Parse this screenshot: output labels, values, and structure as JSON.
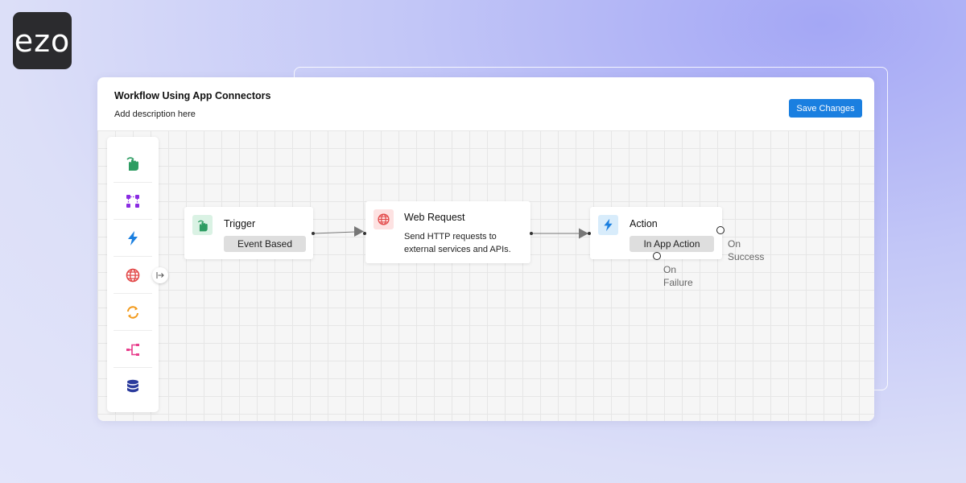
{
  "brand": {
    "logo_text": "ezo"
  },
  "workflow": {
    "title": "Workflow Using App Connectors",
    "description": "Add description here",
    "save_label": "Save Changes"
  },
  "nodes": {
    "trigger": {
      "title": "Trigger",
      "chip": "Event Based"
    },
    "web_request": {
      "title": "Web Request",
      "description_line1": "Send HTTP requests to",
      "description_line2": "external services and APIs."
    },
    "action": {
      "title": "Action",
      "chip": "In App Action",
      "on_success_line1": "On",
      "on_success_line2": "Success",
      "on_failure_line1": "On",
      "on_failure_line2": "Failure"
    }
  },
  "toolbar": {
    "icons": [
      "hand-tap-icon",
      "workflow-nodes-icon",
      "lightning-icon",
      "globe-icon",
      "refresh-icon",
      "branch-icon",
      "database-icon"
    ]
  },
  "colors": {
    "accent_blue": "#1a7fe0",
    "trigger_green": "#2d9c62",
    "nodes_purple": "#8a2be2",
    "lightning_blue": "#1a7fe0",
    "globe_red": "#e24848",
    "refresh_orange": "#f29a1b",
    "branch_pink": "#e83e8c",
    "database_navy": "#2a3a9c"
  }
}
